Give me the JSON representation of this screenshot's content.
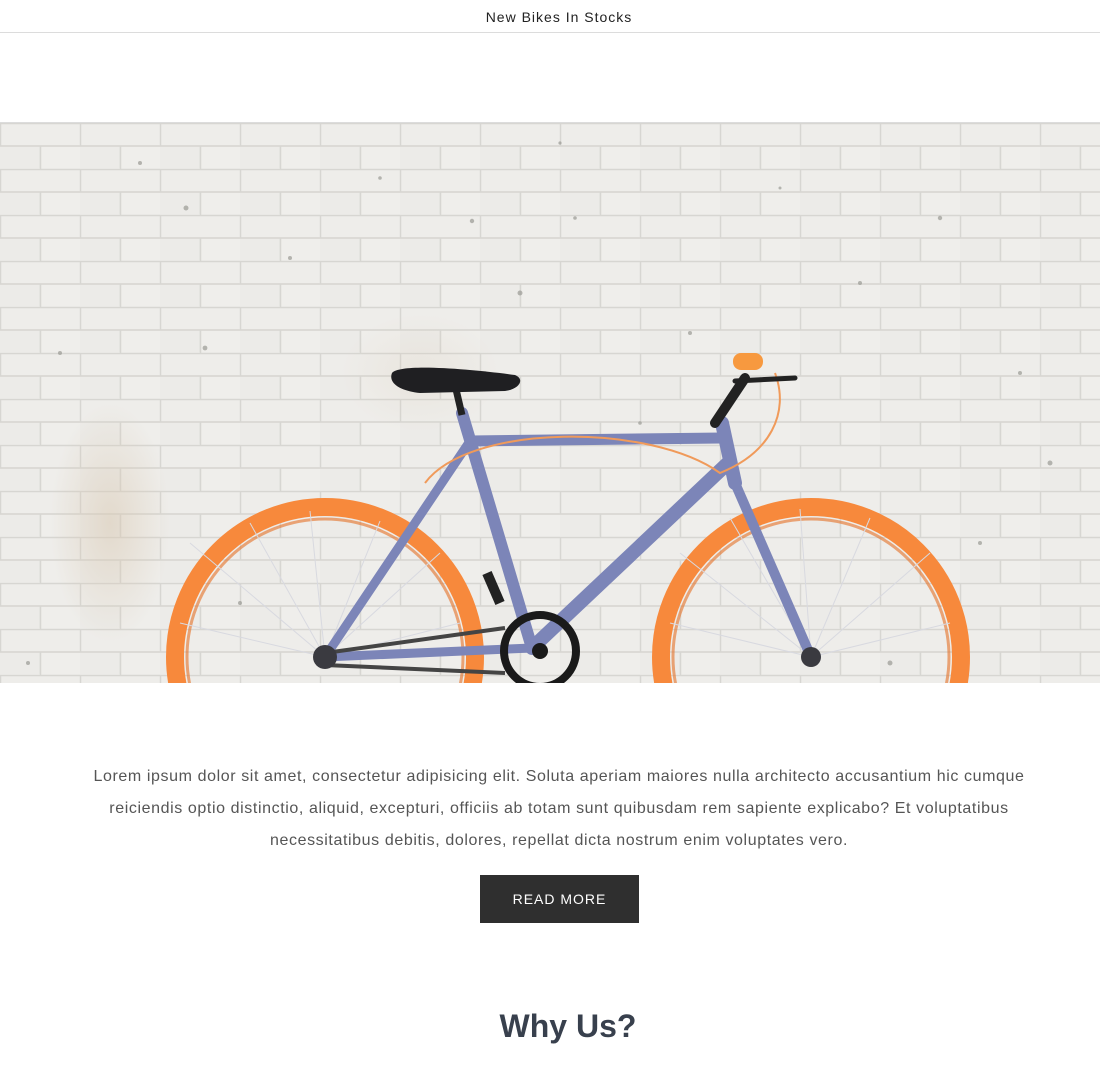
{
  "announcement": {
    "text": "New Bikes In Stocks"
  },
  "hero": {
    "image_subject": "bicycle-photo"
  },
  "intro": {
    "text": "Lorem ipsum dolor sit amet, consectetur adipisicing elit. Soluta aperiam maiores nulla architecto accusantium hic cumque reiciendis optio distinctio, aliquid, excepturi, officiis ab totam sunt quibusdam rem sapiente explicabo? Et voluptatibus necessitatibus debitis, dolores, repellat dicta nostrum enim voluptates vero.",
    "button_label": "READ MORE"
  },
  "section": {
    "heading": "Why Us?"
  },
  "colors": {
    "button_bg": "#2f2f2f",
    "heading": "#38404d",
    "body_text": "#555555",
    "wheel": "#f7893c",
    "frame": "#7c85b8"
  }
}
